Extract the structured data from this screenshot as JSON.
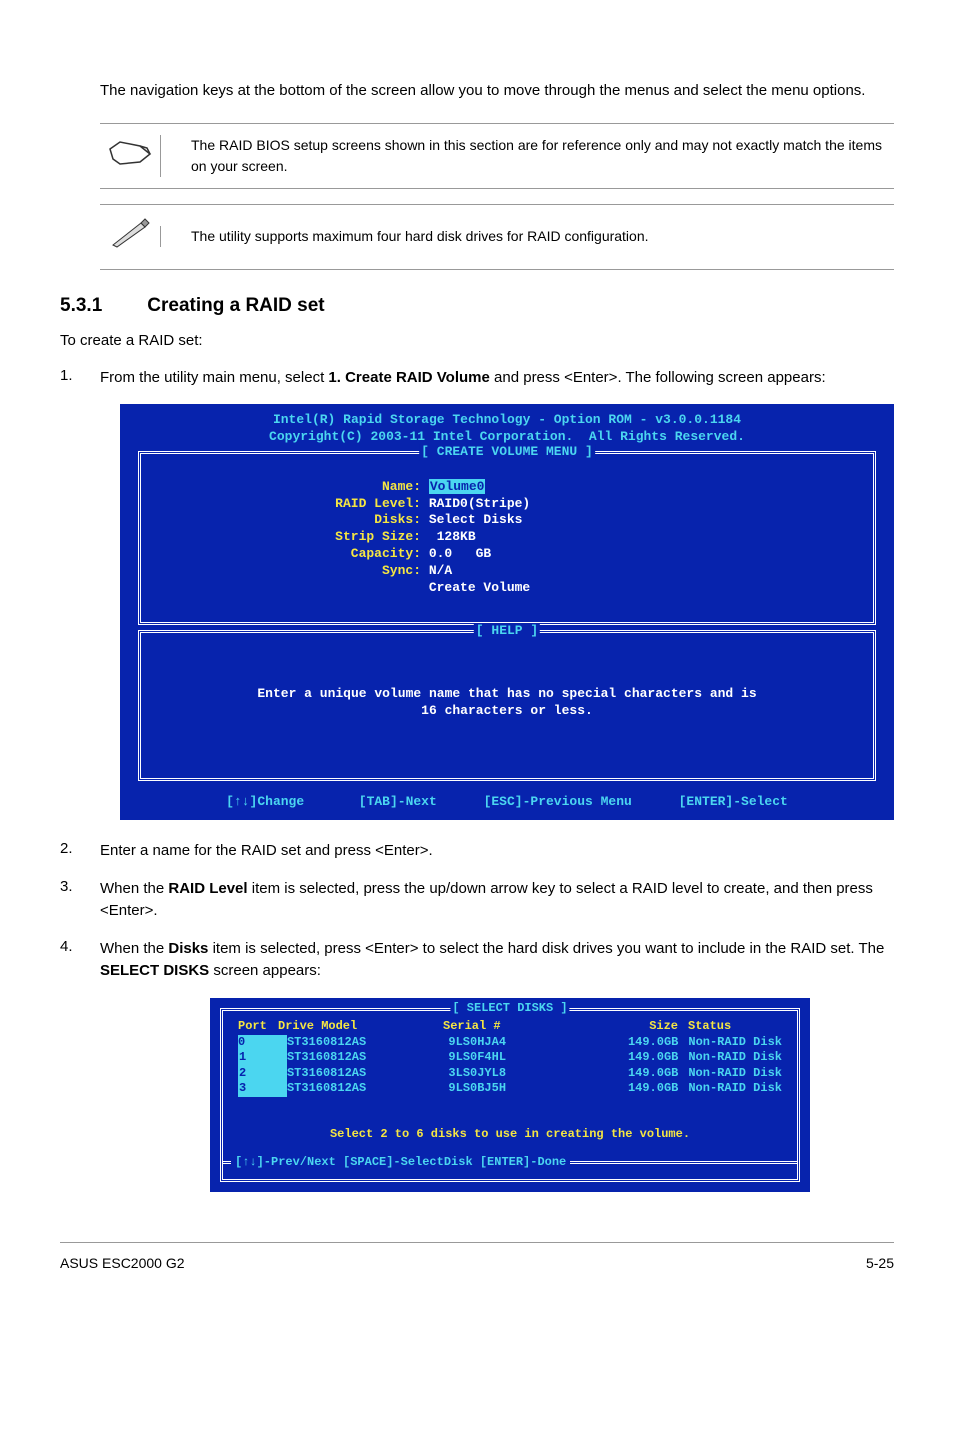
{
  "intro": "The navigation keys at the bottom of the screen allow you to move through the menus and select the menu options.",
  "note1": "The RAID BIOS setup screens shown in this section are for reference only and may not exactly match the items on your screen.",
  "note2": "The utility supports maximum four hard disk drives for RAID configuration.",
  "section": {
    "num": "5.3.1",
    "title": "Creating a RAID set"
  },
  "line1": "To create a RAID set:",
  "step1_pre": "From the utility main menu, select ",
  "step1_bold": "1. Create RAID Volume",
  "step1_post": " and press <Enter>. The following screen appears:",
  "bios1": {
    "header": "Intel(R) Rapid Storage Technology - Option ROM - v3.0.0.1184\nCopyright(C) 2003-11 Intel Corporation.  All Rights Reserved.",
    "box1_title": "[ CREATE VOLUME MENU ]",
    "fields": {
      "name_l": "Name:",
      "name_v": "Volume0",
      "raid_l": "RAID Level:",
      "raid_v": "RAID0(Stripe)",
      "disks_l": "Disks:",
      "disks_v": "Select Disks",
      "strip_l": "Strip Size:",
      "strip_v": " 128KB",
      "cap_l": "Capacity:",
      "cap_v": "0.0   GB",
      "sync_l": "Sync:",
      "sync_v": "N/A",
      "create": "Create Volume"
    },
    "box2_title": "[ HELP ]",
    "help": "Enter a unique volume name that has no special characters and is\n16 characters or less.",
    "footer": "[↑↓]Change       [TAB]-Next      [ESC]-Previous Menu      [ENTER]-Select"
  },
  "step2": "Enter a name for the RAID set and press <Enter>.",
  "step3_pre": "When the ",
  "step3_bold": "RAID Level",
  "step3_post": " item is selected, press the up/down arrow key to select a RAID level to create, and then press <Enter>.",
  "step4_pre": "When the ",
  "step4_b1": "Disks",
  "step4_mid": " item is selected, press <Enter> to select the hard disk drives you want to include in the RAID set. The ",
  "step4_b2": "SELECT DISKS",
  "step4_post": " screen appears:",
  "bios2": {
    "title": "[ SELECT DISKS ]",
    "header": {
      "port": "Port",
      "model": "Drive Model",
      "serial": "Serial #",
      "size": "Size",
      "status": "Status"
    },
    "rows": [
      {
        "port": "0",
        "model": "ST3160812AS",
        "serial": "9LS0HJA4",
        "size": "149.0GB",
        "status": "Non-RAID Disk"
      },
      {
        "port": "1",
        "model": "ST3160812AS",
        "serial": "9LS0F4HL",
        "size": "149.0GB",
        "status": "Non-RAID Disk"
      },
      {
        "port": "2",
        "model": "ST3160812AS",
        "serial": "3LS0JYL8",
        "size": "149.0GB",
        "status": "Non-RAID Disk"
      },
      {
        "port": "3",
        "model": "ST3160812AS",
        "serial": "9LS0BJ5H",
        "size": "149.0GB",
        "status": "Non-RAID Disk"
      }
    ],
    "hint": "Select 2 to 6 disks to use in creating the volume.",
    "footer": "[↑↓]-Prev/Next [SPACE]-SelectDisk [ENTER]-Done"
  },
  "footer": {
    "left": "ASUS ESC2000 G2",
    "right": "5-25"
  }
}
